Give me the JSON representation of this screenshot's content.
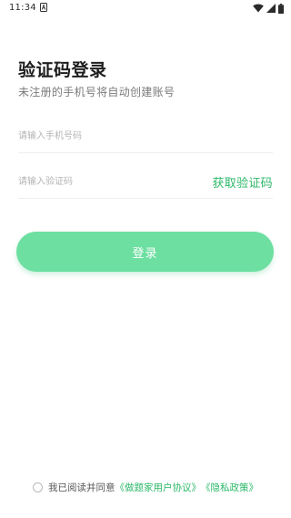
{
  "status_bar": {
    "time": "11:34",
    "icons": [
      "notification-a-icon",
      "wifi-icon",
      "signal-icon",
      "battery-icon"
    ]
  },
  "header": {
    "title": "验证码登录",
    "subtitle": "未注册的手机号将自动创建账号"
  },
  "form": {
    "phone_placeholder": "请输入手机号码",
    "phone_value": "",
    "code_placeholder": "请输入验证码",
    "code_value": "",
    "get_code_label": "获取验证码"
  },
  "login_button": {
    "label": "登录"
  },
  "agreement": {
    "checked": false,
    "text": "我已阅读并同意",
    "user_agreement": "《做题家用户协议》",
    "privacy_policy": "《隐私政策》"
  },
  "colors": {
    "accent": "#2cb869",
    "button": "#6ddfa1",
    "placeholder": "#b4b4b4",
    "subtitle": "#7a7a7a"
  }
}
